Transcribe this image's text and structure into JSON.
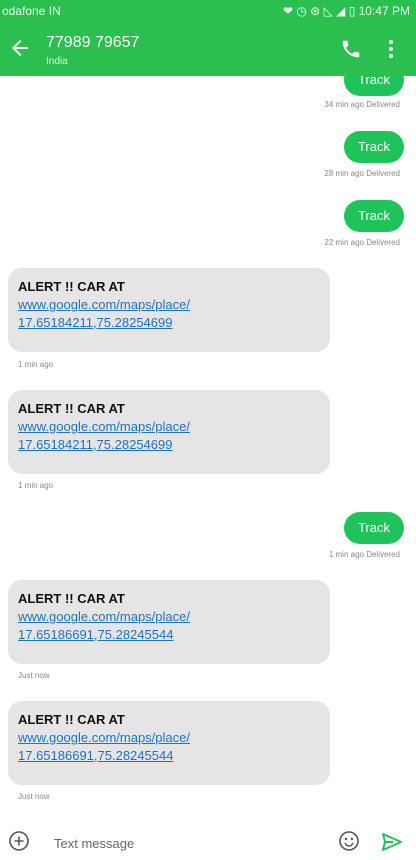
{
  "status_bar": {
    "carrier": "odafone IN",
    "indicators": "❤ ◷ ⊛ ◺ ◢ ▯ 10:47 PM",
    "icons": [
      "message-icon",
      "whatsapp-icon",
      "alarm-icon",
      "signal-icon",
      "battery-icon"
    ]
  },
  "header": {
    "contact_number": "77989 79657",
    "contact_location": "India",
    "back_icon": "arrow-left-icon",
    "call_icon": "phone-icon",
    "more_icon": "more-vert-icon",
    "bar_color": "#2bbf50"
  },
  "messages": [
    {
      "direction": "outgoing",
      "text": "Track",
      "meta": "34 min ago  Delivered"
    },
    {
      "direction": "outgoing",
      "text": "Track",
      "meta": "28 min ago  Delivered"
    },
    {
      "direction": "outgoing",
      "text": "Track",
      "meta": "22 min ago  Delivered"
    },
    {
      "direction": "incoming",
      "line1": "ALERT !! CAR AT",
      "link1": "www.google.com/maps/place/",
      "link2": "17.65184211,75.28254699",
      "meta": "1 min ago"
    },
    {
      "direction": "incoming",
      "line1": "ALERT !! CAR AT",
      "link1": "www.google.com/maps/place/",
      "link2": "17.65184211,75.28254699",
      "meta": "1 min ago"
    },
    {
      "direction": "outgoing",
      "text": "Track",
      "meta": "1 min ago  Delivered"
    },
    {
      "direction": "incoming",
      "line1": "ALERT !! CAR AT",
      "link1": "www.google.com/maps/place/",
      "link2": "17.65186691,75.28245544",
      "meta": "Just now"
    },
    {
      "direction": "incoming",
      "line1": "ALERT !! CAR AT",
      "link1": "www.google.com/maps/place/",
      "link2": "17.65186691,75.28245544",
      "meta": "Just now"
    }
  ],
  "compose": {
    "placeholder": "Text message",
    "value": "",
    "add_icon": "add-circle-icon",
    "emoji_icon": "emoji-icon",
    "send_icon": "send-icon"
  },
  "colors": {
    "accent": "#2bbf50",
    "outgoing_bubble": "#20c25a",
    "incoming_bubble": "#e5e5e5",
    "link": "#1a73c8"
  }
}
